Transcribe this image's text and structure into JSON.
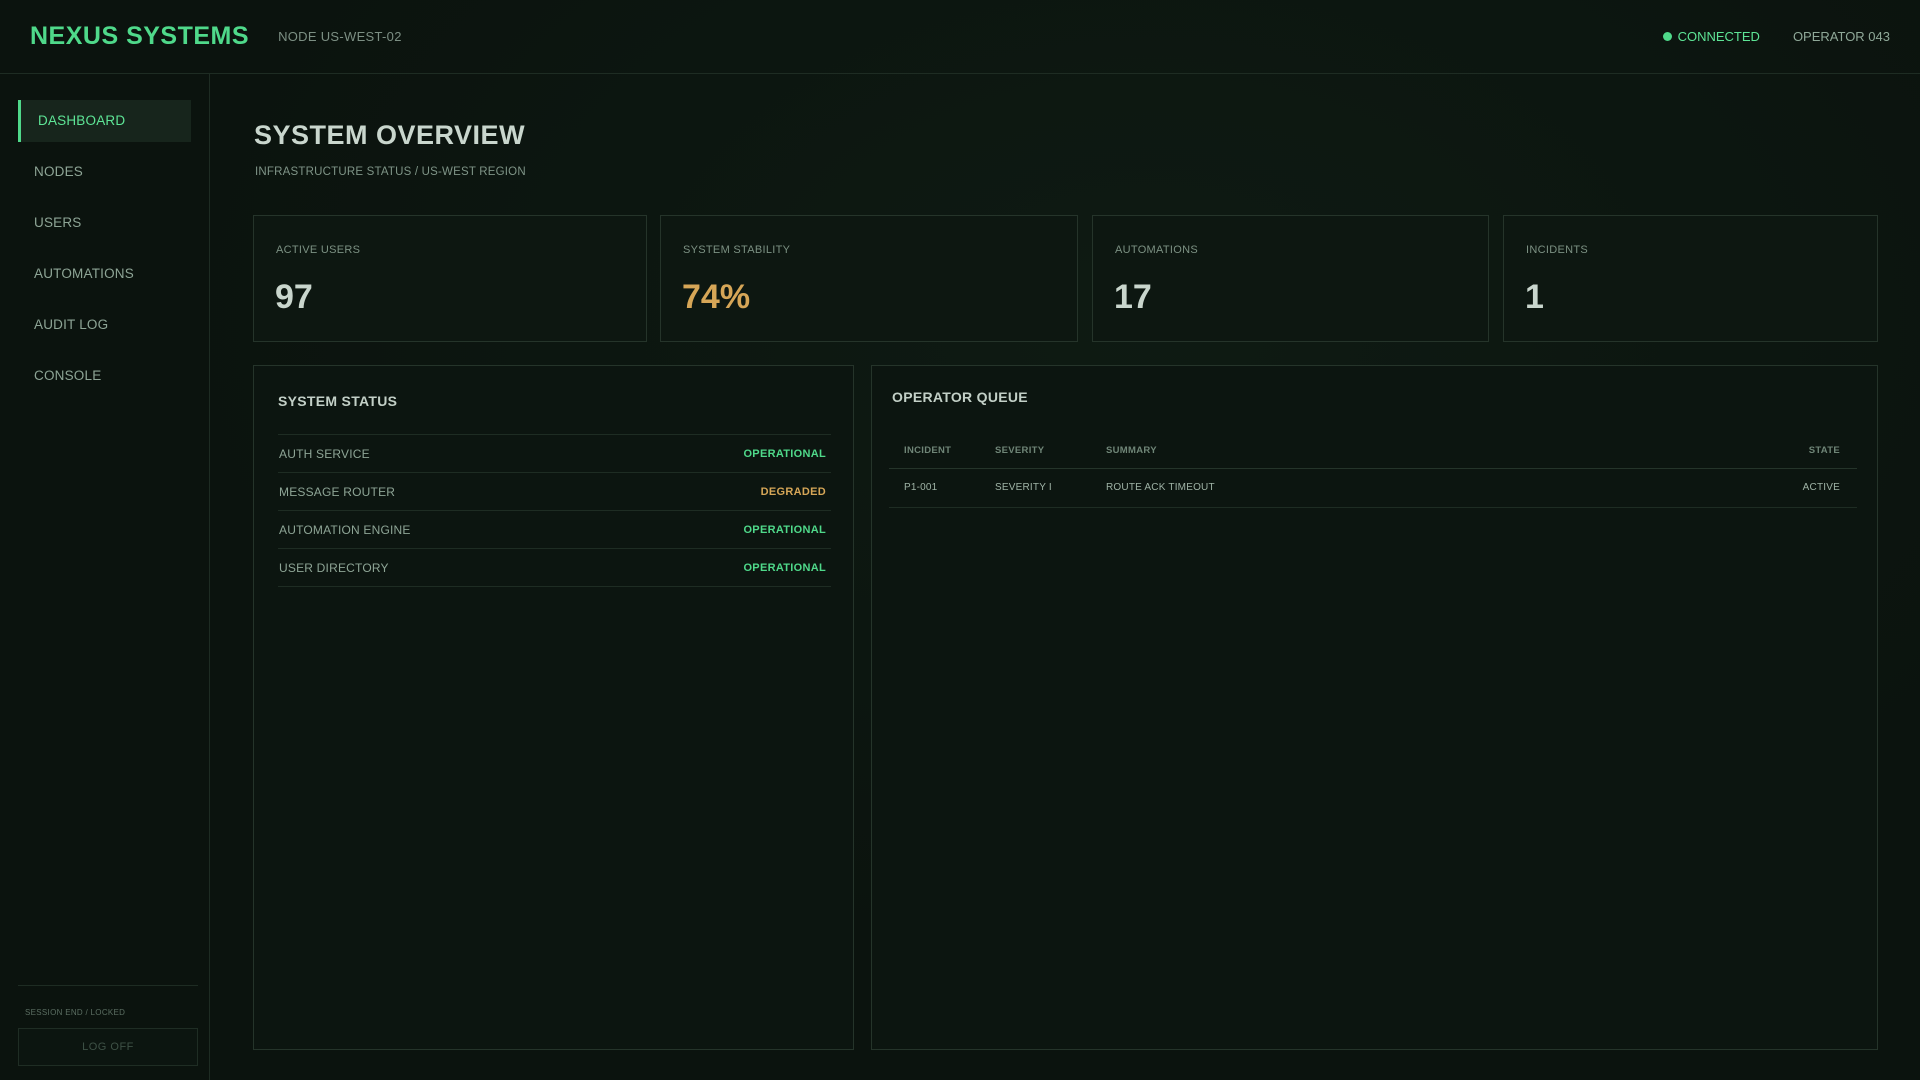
{
  "header": {
    "brand": "NEXUS SYSTEMS",
    "node": "NODE US-WEST-02",
    "connection_status": "CONNECTED",
    "operator": "OPERATOR 043"
  },
  "sidebar": {
    "items": [
      {
        "label": "DASHBOARD",
        "active": true
      },
      {
        "label": "NODES",
        "active": false
      },
      {
        "label": "USERS",
        "active": false
      },
      {
        "label": "AUTOMATIONS",
        "active": false
      },
      {
        "label": "AUDIT LOG",
        "active": false
      },
      {
        "label": "CONSOLE",
        "active": false
      }
    ],
    "session_text": "SESSION END / LOCKED",
    "logoff_label": "LOG OFF"
  },
  "main": {
    "title": "SYSTEM OVERVIEW",
    "breadcrumb": "INFRASTRUCTURE STATUS / US-WEST REGION",
    "stats": [
      {
        "label": "ACTIVE USERS",
        "value": "97"
      },
      {
        "label": "SYSTEM STABILITY",
        "value": "74%"
      },
      {
        "label": "AUTOMATIONS",
        "value": "17"
      },
      {
        "label": "INCIDENTS",
        "value": "1"
      }
    ],
    "system_status": {
      "title": "SYSTEM STATUS",
      "rows": [
        {
          "name": "AUTH SERVICE",
          "status": "OPERATIONAL"
        },
        {
          "name": "MESSAGE ROUTER",
          "status": "DEGRADED"
        },
        {
          "name": "AUTOMATION ENGINE",
          "status": "OPERATIONAL"
        },
        {
          "name": "USER DIRECTORY",
          "status": "OPERATIONAL"
        }
      ]
    },
    "operator_queue": {
      "title": "OPERATOR QUEUE",
      "columns": [
        "INCIDENT",
        "SEVERITY",
        "SUMMARY",
        "STATE"
      ],
      "rows": [
        [
          "P1-001",
          "SEVERITY I",
          "ROUTE ACK TIMEOUT",
          "ACTIVE"
        ]
      ]
    }
  },
  "colors": {
    "accent": "#4fd98a",
    "warning": "#d6a657",
    "background": "#0b130e"
  },
  "icons": {
    "connection": "status-dot-icon"
  }
}
